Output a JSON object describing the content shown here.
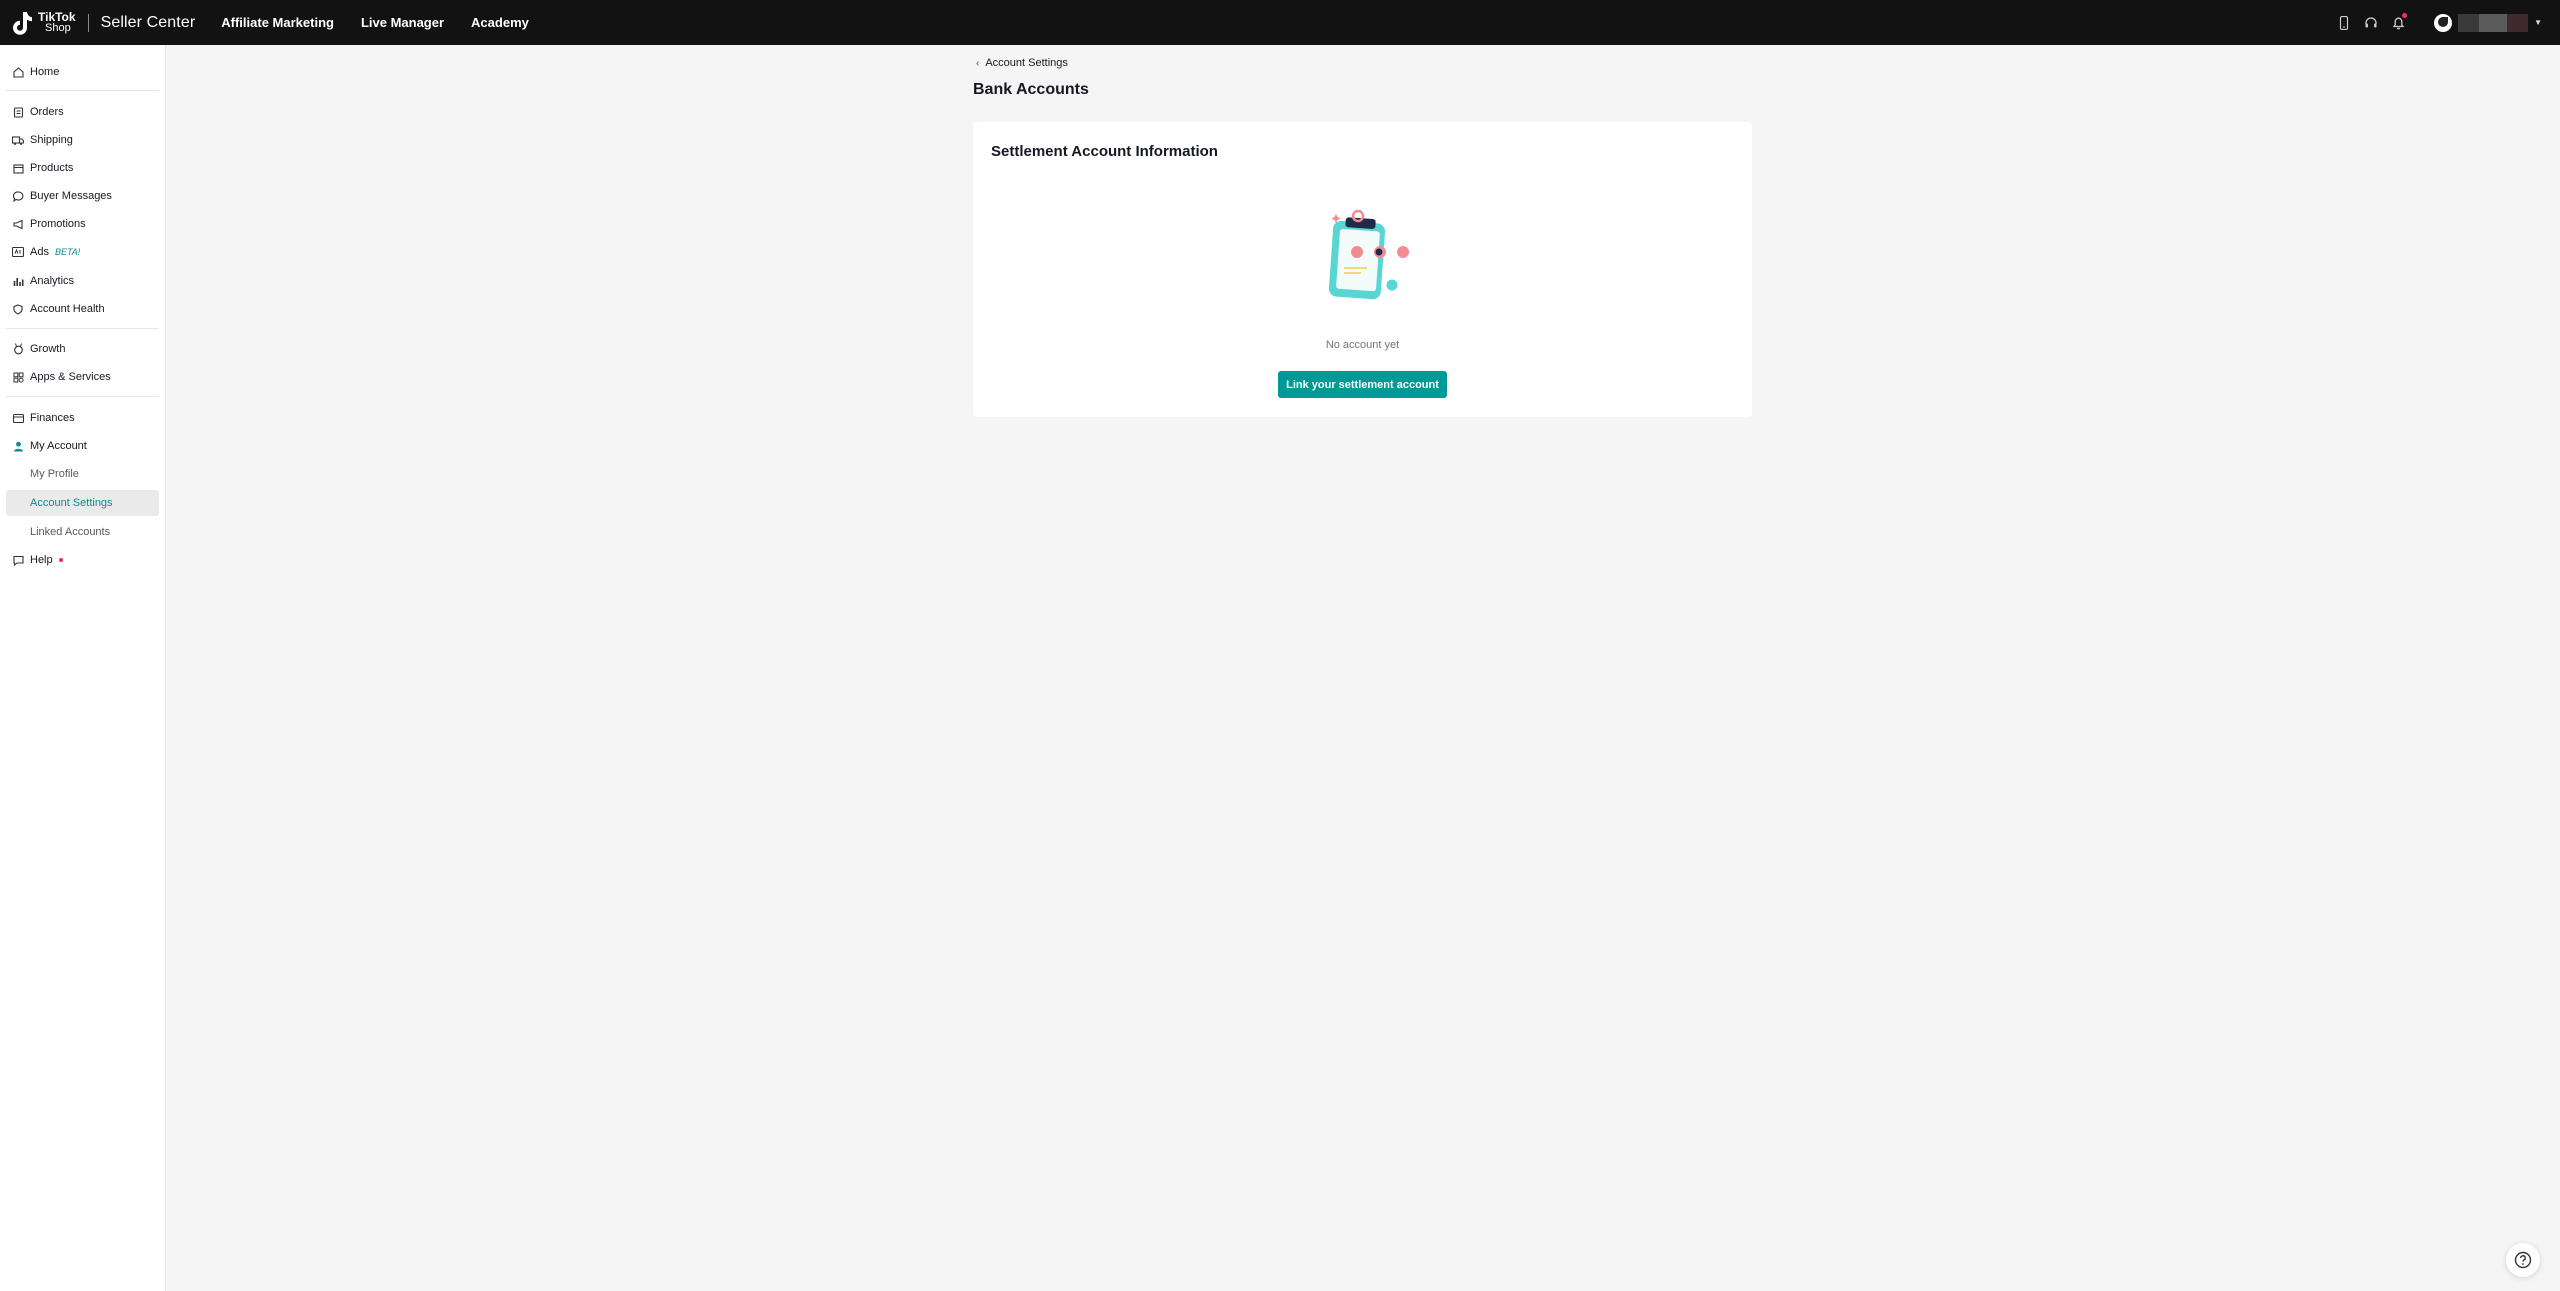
{
  "header": {
    "logo_line1": "TikTok",
    "logo_line2": "Shop",
    "brand": "Seller Center",
    "nav": [
      {
        "label": "Affiliate Marketing"
      },
      {
        "label": "Live Manager"
      },
      {
        "label": "Academy"
      }
    ],
    "icons": [
      "mobile-icon",
      "headset-icon",
      "bell-icon"
    ]
  },
  "sidebar": {
    "items": [
      {
        "label": "Home",
        "icon": "home-icon"
      },
      {
        "label": "Orders",
        "icon": "orders-icon"
      },
      {
        "label": "Shipping",
        "icon": "truck-icon"
      },
      {
        "label": "Products",
        "icon": "box-icon"
      },
      {
        "label": "Buyer Messages",
        "icon": "chat-icon"
      },
      {
        "label": "Promotions",
        "icon": "megaphone-icon"
      },
      {
        "label": "Ads",
        "icon": "ads-icon",
        "badge": "BETA!"
      },
      {
        "label": "Analytics",
        "icon": "bar-chart-icon"
      },
      {
        "label": "Account Health",
        "icon": "shield-icon"
      },
      {
        "label": "Growth",
        "icon": "medal-icon"
      },
      {
        "label": "Apps & Services",
        "icon": "apps-icon"
      },
      {
        "label": "Finances",
        "icon": "wallet-icon"
      },
      {
        "label": "My Account",
        "icon": "user-icon"
      },
      {
        "label": "My Profile"
      },
      {
        "label": "Account Settings"
      },
      {
        "label": "Linked Accounts"
      },
      {
        "label": "Help",
        "icon": "help-book-icon"
      }
    ],
    "active": "Account Settings"
  },
  "main": {
    "breadcrumb": "Account Settings",
    "title": "Bank Accounts",
    "card": {
      "title": "Settlement Account Information",
      "empty_text": "No account yet",
      "button": "Link your settlement account"
    }
  },
  "colors": {
    "topbar": "#121212",
    "accent": "#009995",
    "active_text": "#108a8e",
    "notification": "#fe2c55"
  }
}
